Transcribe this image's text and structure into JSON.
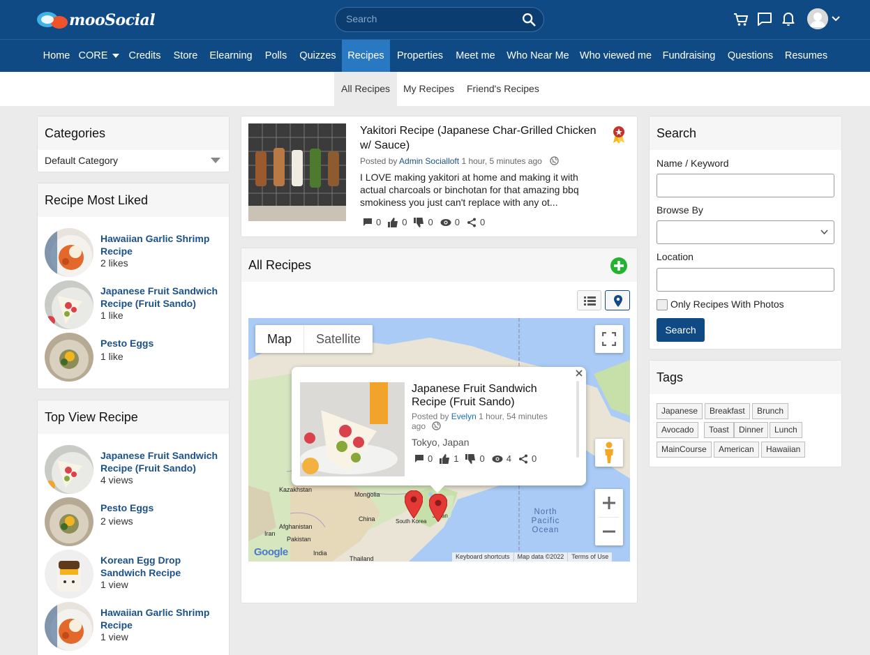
{
  "header": {
    "logo_text": "mooSocial",
    "search_placeholder": "Search"
  },
  "nav": {
    "items": [
      {
        "label": "Home"
      },
      {
        "label": "CORE"
      },
      {
        "label": "Credits"
      },
      {
        "label": "Store"
      },
      {
        "label": "Elearning"
      },
      {
        "label": "Polls"
      },
      {
        "label": "Quizzes"
      },
      {
        "label": "Recipes"
      },
      {
        "label": "Properties"
      },
      {
        "label": "Meet me"
      },
      {
        "label": "Who Near Me"
      },
      {
        "label": "Who viewed me"
      },
      {
        "label": "Fundraising"
      },
      {
        "label": "Questions"
      },
      {
        "label": "Resumes"
      }
    ],
    "active": "Recipes"
  },
  "subnav": {
    "items": [
      {
        "label": "All Recipes"
      },
      {
        "label": "My Recipes"
      },
      {
        "label": "Friend's Recipes"
      }
    ]
  },
  "categories": {
    "title": "Categories",
    "selected": "Default Category"
  },
  "most_liked": {
    "title": "Recipe Most Liked",
    "items": [
      {
        "title": "Hawaiian Garlic Shrimp Recipe",
        "meta": "2 likes"
      },
      {
        "title": "Japanese Fruit Sandwich Recipe (Fruit Sando)",
        "meta": "1 like"
      },
      {
        "title": "Pesto Eggs",
        "meta": "1 like"
      }
    ]
  },
  "top_view": {
    "title": "Top View Recipe",
    "items": [
      {
        "title": "Japanese Fruit Sandwich Recipe (Fruit Sando)",
        "meta": "4 views"
      },
      {
        "title": "Pesto Eggs",
        "meta": "2 views"
      },
      {
        "title": "Korean Egg Drop Sandwich Recipe",
        "meta": "1 view"
      },
      {
        "title": "Hawaiian Garlic Shrimp Recipe",
        "meta": "1 view"
      }
    ]
  },
  "featured": {
    "title": "Yakitori Recipe (Japanese Char-Grilled Chicken w/ Sauce)",
    "posted_by": "Posted by",
    "author": "Admin Socialloft",
    "time": "1 hour, 5 minutes ago",
    "description": "I LOVE making yakitori at home and making it with actual charcoals or binchotan for that amazing bbq smokiness you just can't replace with any ot...",
    "stats": {
      "comments": "0",
      "likes": "0",
      "dislikes": "0",
      "views": "0",
      "shares": "0"
    }
  },
  "all_recipes": {
    "title": "All Recipes"
  },
  "map": {
    "type_map": "Map",
    "type_satellite": "Satellite",
    "info": {
      "title": "Japanese Fruit Sandwich Recipe (Fruit Sando)",
      "posted_by": "Posted by",
      "author": "Evelyn",
      "time": "1 hour, 54 minutes ago",
      "location": "Tokyo, Japan",
      "stats": {
        "comments": "0",
        "likes": "1",
        "dislikes": "0",
        "views": "4",
        "shares": "0"
      }
    },
    "labels": {
      "kazakhstan": "Kazakhstan",
      "mongolia": "Mongolia",
      "china": "China",
      "south_korea": "South Korea",
      "japan": "Japan",
      "afghanistan": "Afghanistan",
      "iran": "Iran",
      "pakistan": "Pakistan",
      "india": "India",
      "thailand": "Thailand",
      "ocean": "North Pacific Ocean"
    },
    "footer": {
      "shortcuts": "Keyboard shortcuts",
      "data": "Map data ©2022",
      "terms": "Terms of Use"
    },
    "google": "Google"
  },
  "search_panel": {
    "title": "Search",
    "name_label": "Name / Keyword",
    "browse_label": "Browse By",
    "location_label": "Location",
    "photos_label": "Only Recipes With Photos",
    "button": "Search"
  },
  "tags": {
    "title": "Tags",
    "items": [
      {
        "label": "Japanese"
      },
      {
        "label": "Breakfast"
      },
      {
        "label": "Brunch"
      },
      {
        "label": "Avocado"
      },
      {
        "label": "Toast"
      },
      {
        "label": "Dinner"
      },
      {
        "label": "Lunch"
      },
      {
        "label": "MainCourse"
      },
      {
        "label": "American"
      },
      {
        "label": "Hawaiian"
      }
    ]
  }
}
